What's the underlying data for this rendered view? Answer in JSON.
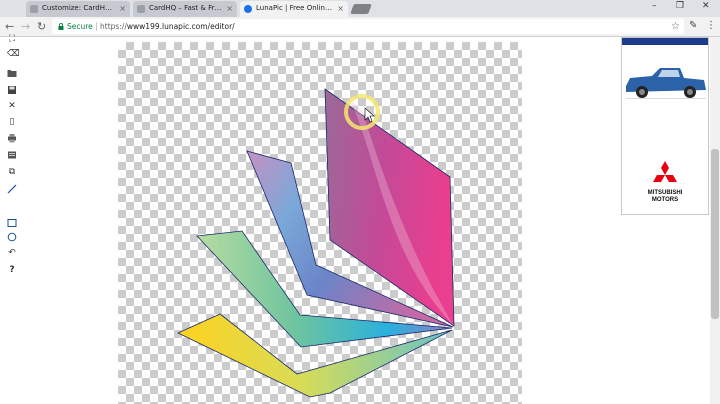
{
  "browser": {
    "tabs": [
      {
        "title": "Customize: CardHQ – Fa",
        "favicon_color": "#9aa0a6",
        "active": false
      },
      {
        "title": "CardHQ – Fast & Free Bu",
        "favicon_color": "#9aa0a6",
        "active": false
      },
      {
        "title": "LunaPic | Free Online Ph",
        "favicon_color": "#1a73e8",
        "active": true
      }
    ],
    "close_glyph": "×",
    "new_tab_icon": "new-tab-icon",
    "window_controls": {
      "minimize": "–",
      "restore": "❐",
      "close": "✕"
    },
    "nav": {
      "back": "←",
      "forward": "→",
      "reload": "↻"
    },
    "address": {
      "secure_label": "Secure",
      "url_scheme": "https://",
      "url_host": "www199.lunapic.com/editor/"
    },
    "toolbar_icons": {
      "star": "☆",
      "pen": "✎",
      "menu": "⋮"
    }
  },
  "editor": {
    "tools": [
      {
        "name": "crop-tool-icon",
        "glyph": "⛶"
      },
      {
        "name": "eraser-tool-icon",
        "glyph": "⌫"
      },
      {
        "name": "open-icon",
        "glyph": "📂"
      },
      {
        "name": "save-icon",
        "glyph": "💾"
      },
      {
        "name": "close-image-icon",
        "glyph": "✕"
      },
      {
        "name": "new-document-icon",
        "glyph": "▯"
      },
      {
        "name": "print-icon",
        "glyph": "⎙"
      },
      {
        "name": "layers-icon",
        "glyph": "▤"
      },
      {
        "name": "copy-icon",
        "glyph": "⧉"
      },
      {
        "name": "line-tool-icon",
        "glyph": "╱"
      },
      {
        "name": "rectangle-tool-icon",
        "glyph": "□"
      },
      {
        "name": "ellipse-tool-icon",
        "glyph": "○"
      },
      {
        "name": "undo-icon",
        "glyph": "↶"
      },
      {
        "name": "help-icon",
        "glyph": "?"
      }
    ],
    "canvas_background": "transparent-checkerboard",
    "artwork": "fan-of-gradient-shards",
    "cursor_highlight_color": "#f5e86a"
  },
  "advert": {
    "brand_line1": "MITSUBISHI",
    "brand_line2": "MOTORS",
    "logo_color": "#e60012",
    "car_color": "#2b62a8"
  }
}
